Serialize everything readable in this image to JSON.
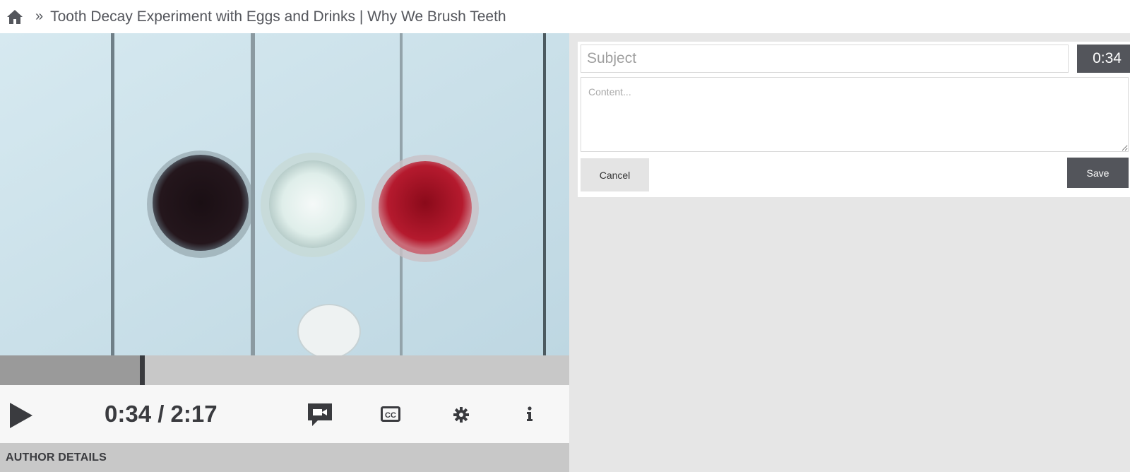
{
  "breadcrumb": {
    "home_icon": "home-icon",
    "separator": "»",
    "title": "Tooth Decay Experiment with Eggs and Drinks | Why We Brush Teeth"
  },
  "player": {
    "progress_fraction": 0.248,
    "current_time": "0:34",
    "duration": "2:17",
    "time_display": "0:34 / 2:17",
    "icons": {
      "play": "play-icon",
      "comment": "video-comment-icon",
      "captions": "closed-captions-icon",
      "settings": "gear-icon",
      "info": "info-icon"
    }
  },
  "author_section": {
    "label": "AUTHOR DETAILS"
  },
  "note_form": {
    "subject_placeholder": "Subject",
    "timestamp": "0:34",
    "content_placeholder": "Content...",
    "cancel_label": "Cancel",
    "save_label": "Save"
  },
  "colors": {
    "dark_accent": "#53555b",
    "panel_bg": "#e6e6e6",
    "text": "#54565c"
  }
}
